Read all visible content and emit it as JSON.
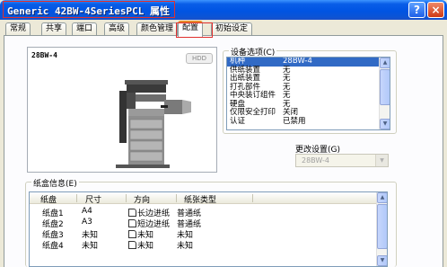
{
  "window": {
    "title": "Generic 42BW-4SeriesPCL 属性",
    "help_label": "?",
    "close_label": "×"
  },
  "tabs": [
    {
      "label": "常规"
    },
    {
      "label": "共享"
    },
    {
      "label": "端口"
    },
    {
      "label": "高级"
    },
    {
      "label": "颜色管理"
    },
    {
      "label": "配置",
      "active": true
    },
    {
      "label": "初始设定"
    }
  ],
  "preview": {
    "model": "28BW-4",
    "badge": "HDD"
  },
  "device_options": {
    "title": "设备选项(C)",
    "items": [
      {
        "name": "机种",
        "value": "28BW-4",
        "selected": true
      },
      {
        "name": "供纸装置",
        "value": "无"
      },
      {
        "name": "出纸装置",
        "value": "无"
      },
      {
        "name": "打孔部件",
        "value": "无"
      },
      {
        "name": "中央装订组件",
        "value": "无"
      },
      {
        "name": "硬盘",
        "value": "无"
      },
      {
        "name": "仅限安全打印",
        "value": "关闭"
      },
      {
        "name": "认证",
        "value": "已禁用"
      }
    ]
  },
  "change_setting": {
    "label": "更改设置(G)",
    "value": "28BW-4"
  },
  "paper_info": {
    "title": "纸盒信息(E)",
    "columns": [
      "纸盘",
      "尺寸",
      "方向",
      "纸张类型"
    ],
    "rows": [
      {
        "tray": "纸盘1",
        "size": "A4",
        "orientation": "长边进纸",
        "type": "普通纸"
      },
      {
        "tray": "纸盘2",
        "size": "A3",
        "orientation": "短边进纸",
        "type": "普通纸"
      },
      {
        "tray": "纸盘3",
        "size": "未知",
        "orientation": "未知",
        "type": "未知"
      },
      {
        "tray": "纸盘4",
        "size": "未知",
        "orientation": "未知",
        "type": "未知"
      }
    ]
  },
  "colors": {
    "title_bar": "#0054e3",
    "highlight": "#e0302f",
    "selection": "#316ac5"
  }
}
